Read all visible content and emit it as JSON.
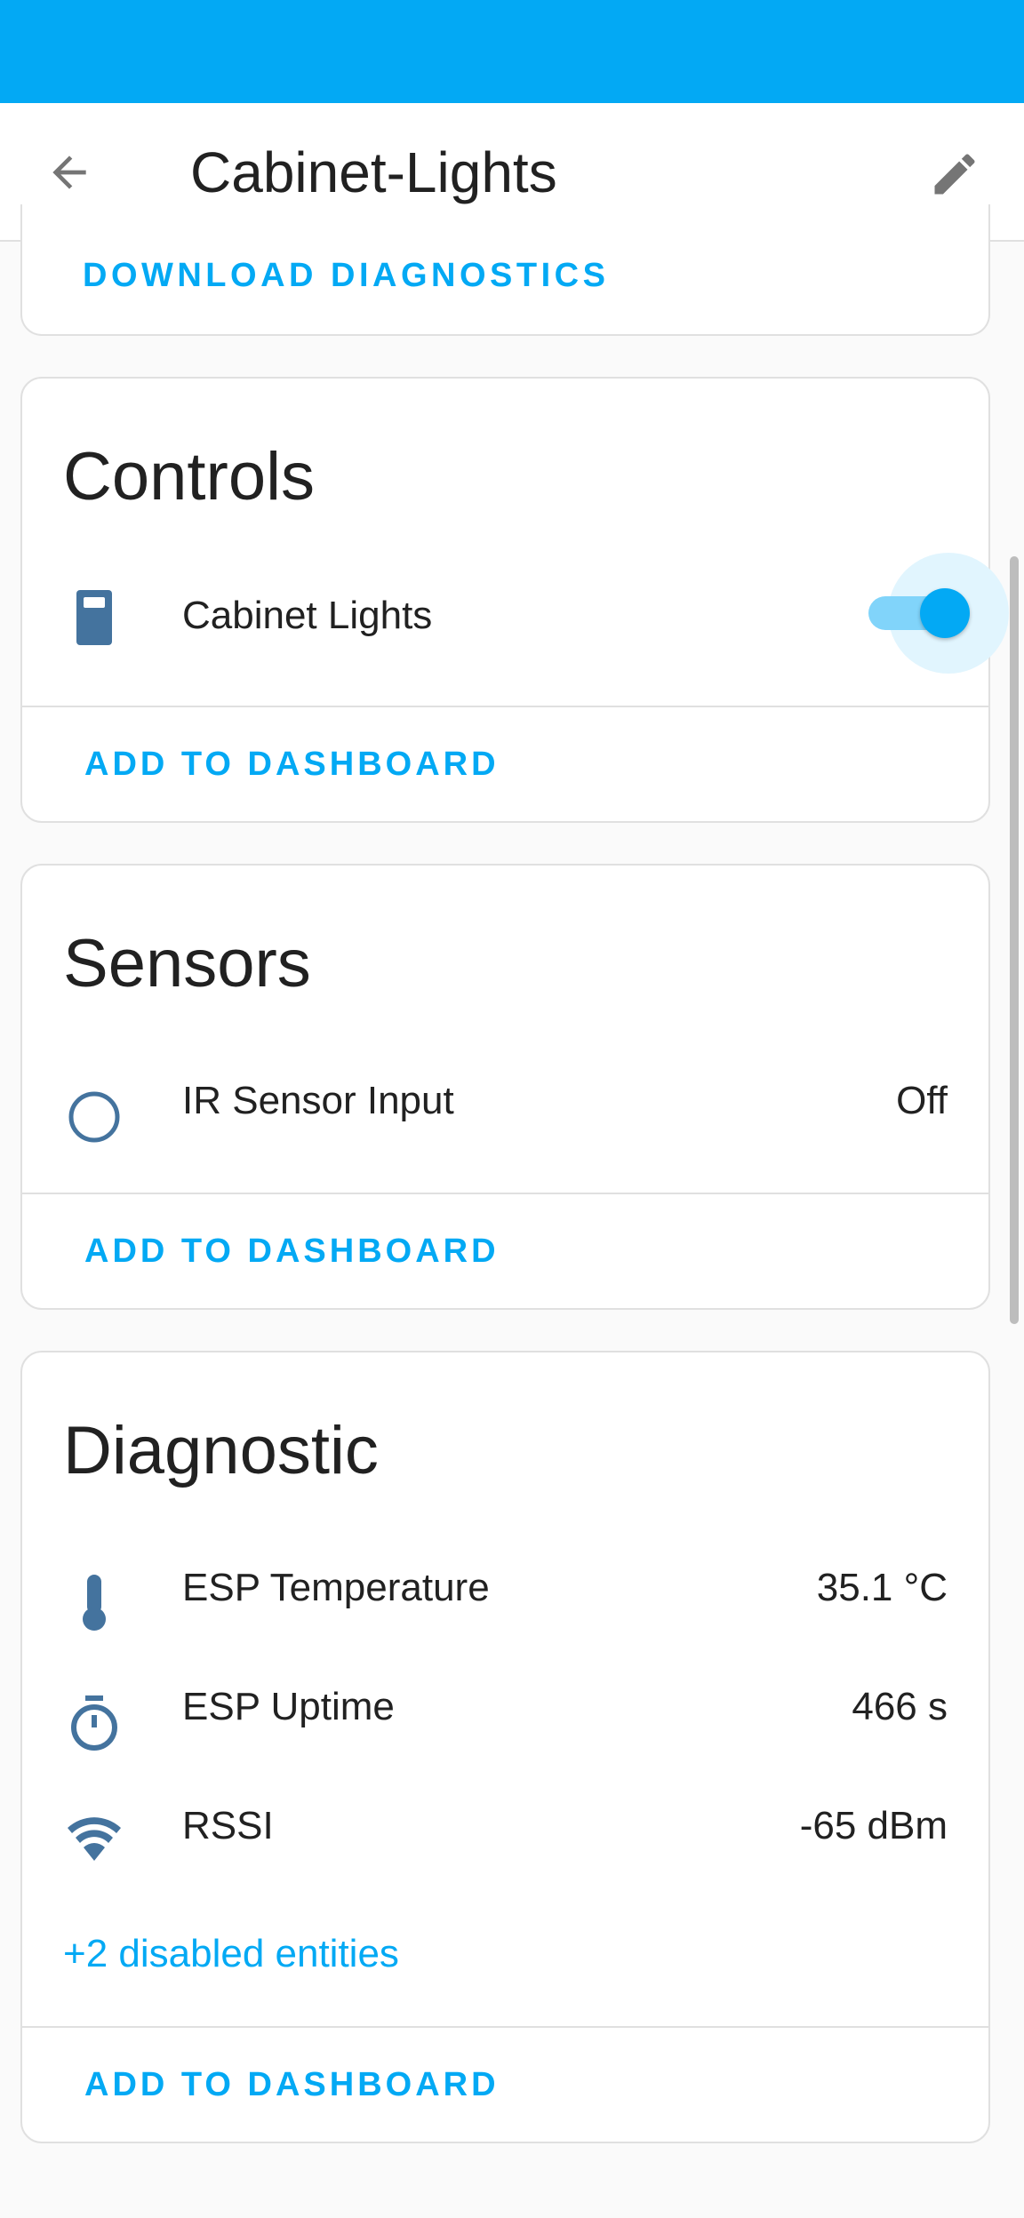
{
  "colors": {
    "status_bar": "#03a9f4",
    "accent": "#03a9f4",
    "icon": "#44739e"
  },
  "header": {
    "title": "Cabinet-Lights",
    "back_icon": "arrow-left-icon",
    "edit_icon": "pencil-icon"
  },
  "diagnostics_card": {
    "download_label": "DOWNLOAD DIAGNOSTICS"
  },
  "controls": {
    "title": "Controls",
    "items": [
      {
        "label": "Cabinet Lights",
        "icon": "light-switch-icon",
        "state": "on"
      }
    ],
    "add_label": "ADD TO DASHBOARD"
  },
  "sensors": {
    "title": "Sensors",
    "items": [
      {
        "label": "IR Sensor Input",
        "value": "Off",
        "icon": "circle-outline-icon"
      }
    ],
    "add_label": "ADD TO DASHBOARD"
  },
  "diagnostic": {
    "title": "Diagnostic",
    "items": [
      {
        "label": "ESP Temperature",
        "value": "35.1 °C",
        "icon": "thermometer-icon"
      },
      {
        "label": "ESP Uptime",
        "value": "466 s",
        "icon": "timer-icon"
      },
      {
        "label": "RSSI",
        "value": "-65 dBm",
        "icon": "wifi-icon"
      }
    ],
    "disabled_link": "+2 disabled entities",
    "add_label": "ADD TO DASHBOARD"
  }
}
